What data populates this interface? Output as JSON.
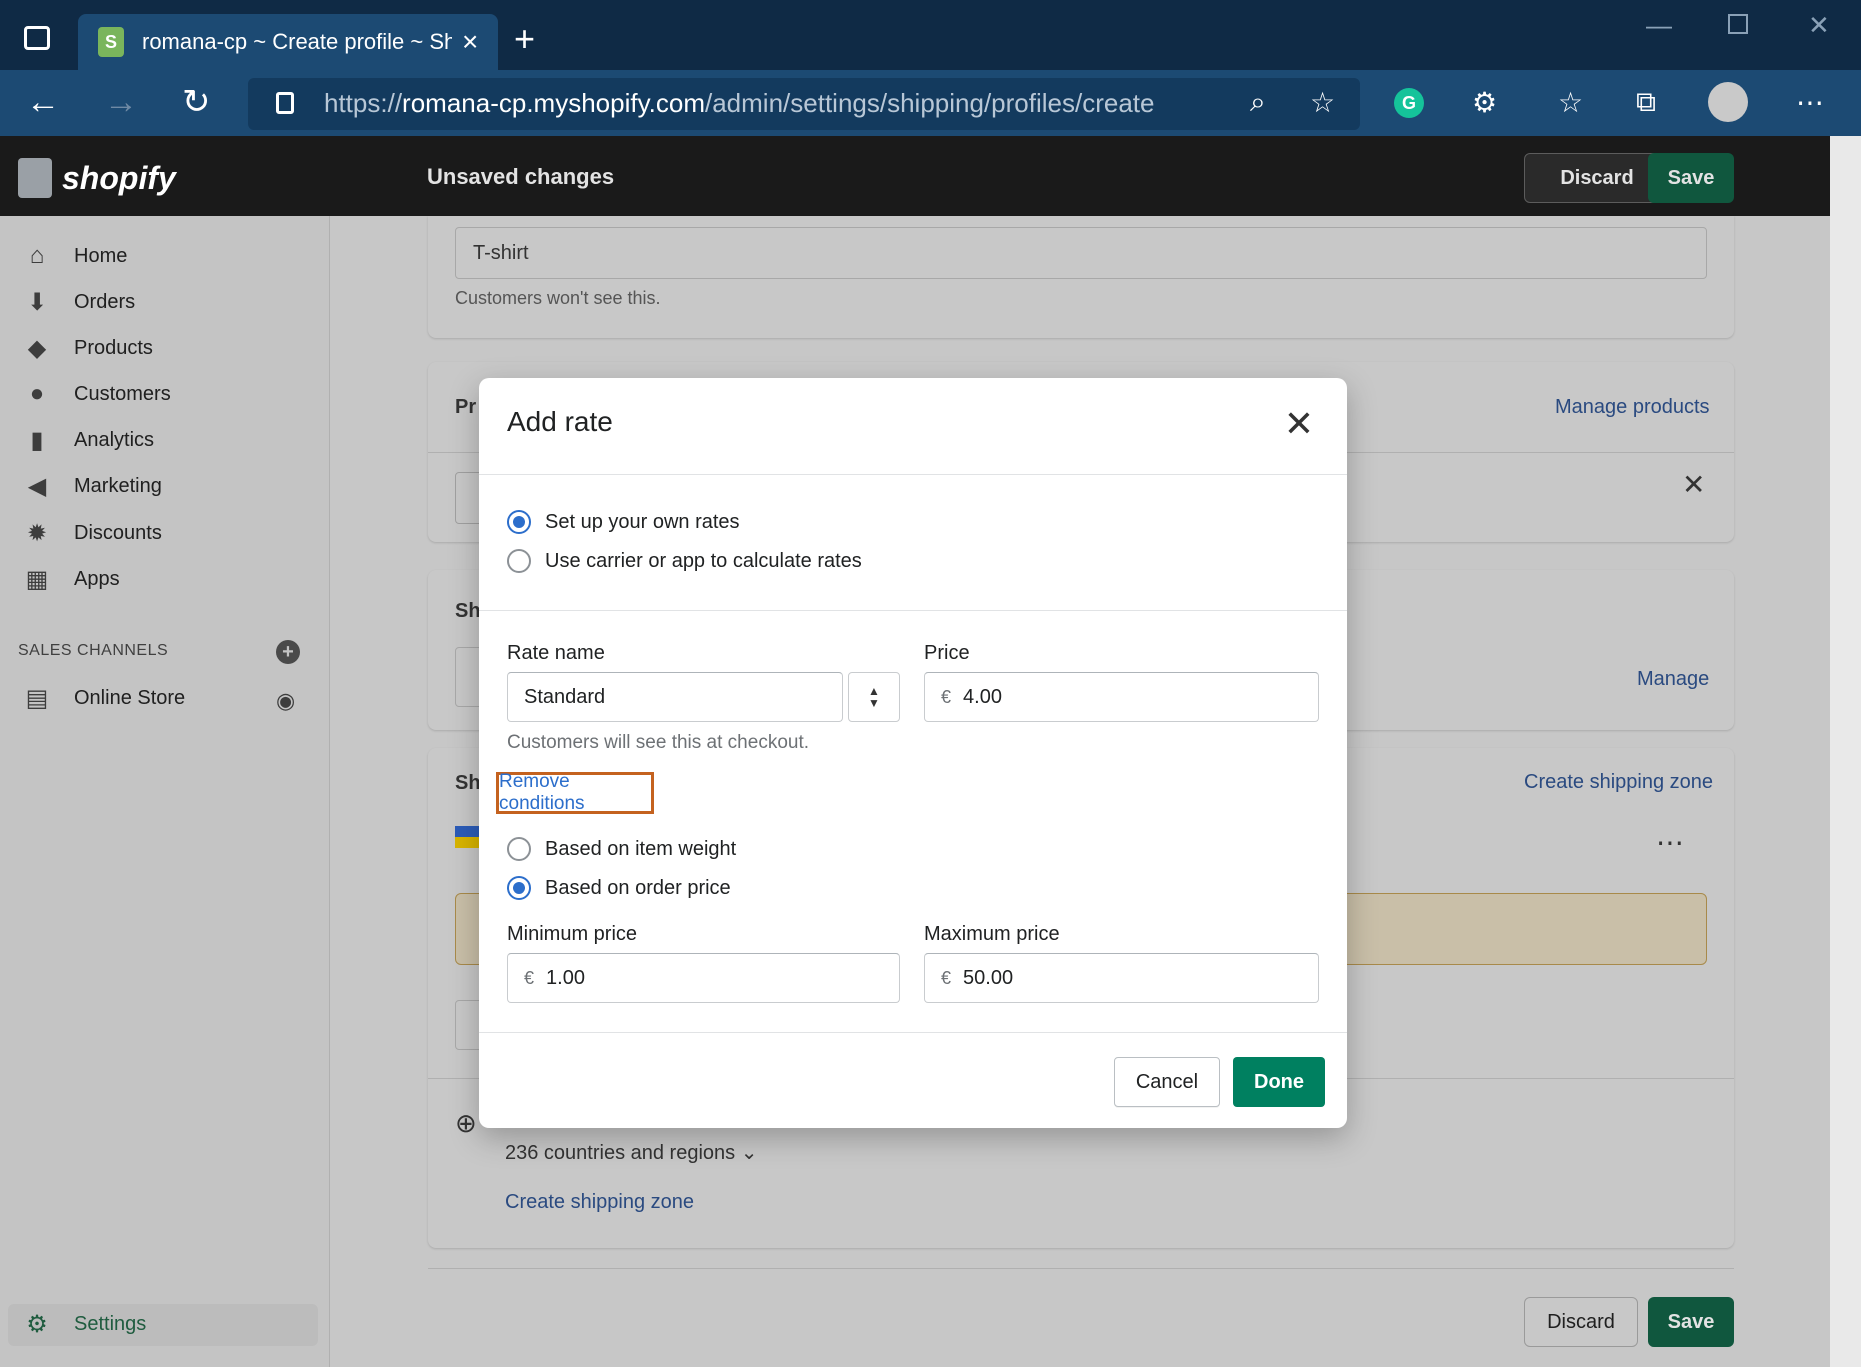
{
  "browser": {
    "tab_title": "romana-cp ~ Create profile ~ Sh",
    "url_prefix": "https://",
    "url_domain": "romana-cp.myshopify.com",
    "url_path": "/admin/settings/shipping/profiles/create"
  },
  "topbar": {
    "logo": "shopify",
    "status": "Unsaved changes",
    "discard": "Discard",
    "save": "Save"
  },
  "sidebar": {
    "items": [
      {
        "label": "Home",
        "icon": "home-icon"
      },
      {
        "label": "Orders",
        "icon": "orders-icon"
      },
      {
        "label": "Products",
        "icon": "tag-icon"
      },
      {
        "label": "Customers",
        "icon": "person-icon"
      },
      {
        "label": "Analytics",
        "icon": "bar-chart-icon"
      },
      {
        "label": "Marketing",
        "icon": "megaphone-icon"
      },
      {
        "label": "Discounts",
        "icon": "discount-icon"
      },
      {
        "label": "Apps",
        "icon": "apps-icon"
      }
    ],
    "sales_channels": "SALES CHANNELS",
    "online_store": "Online Store",
    "settings": "Settings"
  },
  "page": {
    "profile_name_value": "T-shirt",
    "profile_name_help": "Customers won't see this.",
    "products_heading": "Pr",
    "manage_products": "Manage products",
    "shipping_heading_1": "Sh",
    "manage": "Manage",
    "shipping_heading_2": "Sh",
    "create_shipping_zone": "Create shipping zone",
    "countries": "236 countries and regions",
    "create_shipping_zone_2": "Create shipping zone",
    "discard": "Discard",
    "save": "Save"
  },
  "modal": {
    "title": "Add rate",
    "option_own": "Set up your own rates",
    "option_carrier": "Use carrier or app to calculate rates",
    "rate_name_label": "Rate name",
    "rate_name_value": "Standard",
    "rate_name_help": "Customers will see this at checkout.",
    "price_label": "Price",
    "currency": "€",
    "price_value": "4.00",
    "remove_conditions": "Remove conditions",
    "cond_weight": "Based on item weight",
    "cond_price": "Based on order price",
    "min_label": "Minimum price",
    "min_value": "1.00",
    "max_label": "Maximum price",
    "max_value": "50.00",
    "cancel": "Cancel",
    "done": "Done"
  },
  "colors": {
    "primary": "#008060",
    "link": "#2c6ecb",
    "highlight": "#c4621f"
  }
}
